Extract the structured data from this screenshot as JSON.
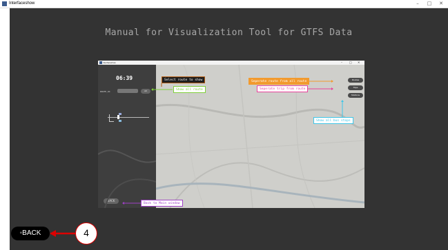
{
  "window": {
    "title": "Interfaceshow",
    "minimize": "–",
    "maximize": "□",
    "close": "✕"
  },
  "page": {
    "title": "Manual for Visualization Tool for GTFS Data",
    "back_label": "◦BACK",
    "step_number": "4"
  },
  "screenshot": {
    "title": "Interfaceshow",
    "clock": "06:39",
    "route_label": "ROUTE_ID",
    "all_button": "All",
    "back_button": "BACK",
    "buttons": [
      "Routes",
      "Trips",
      "Stations"
    ]
  },
  "annotations": {
    "select_route": "Select route to show",
    "show_all_route": "Show all route",
    "separate_route": "Seperate route from all route",
    "separate_trip": "Seperate trip from route",
    "show_bus_stops": "Show all bus stops",
    "back_to_main": "Back to Main window"
  },
  "colors": {
    "background": "#333333",
    "arrow_red": "#dd0000",
    "select_route": "#b15a10",
    "show_all_route": "#7fcf3a",
    "separate_route": "#f29a2e",
    "separate_trip": "#e8409a",
    "bus_stops": "#3ec6e8",
    "back_to_main": "#a040c8"
  },
  "icons": [
    "app-icon",
    "arrow-left-icon"
  ]
}
